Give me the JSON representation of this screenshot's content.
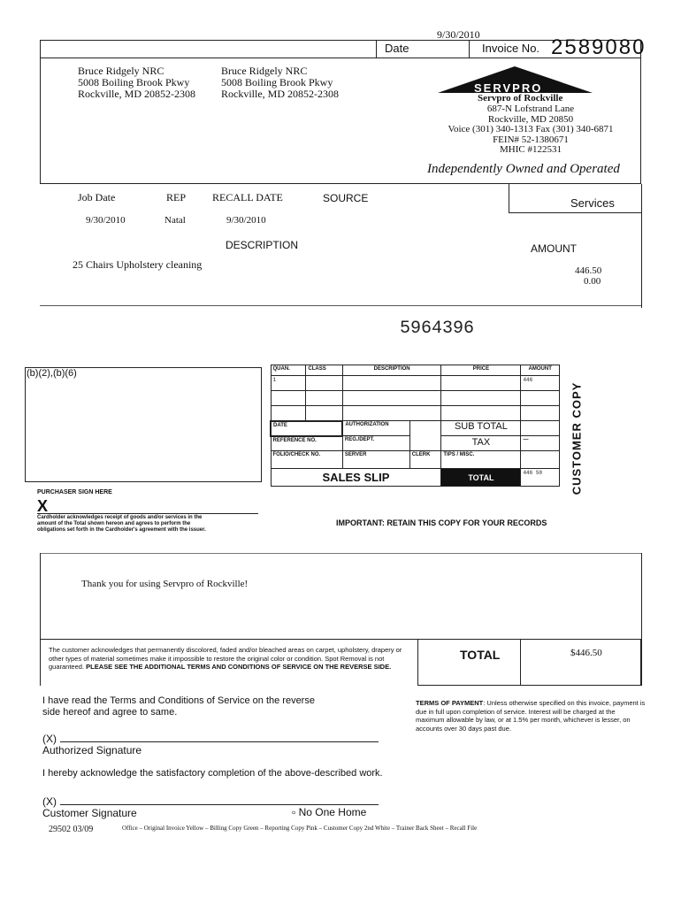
{
  "header": {
    "top_date": "9/30/2010",
    "date_label": "Date",
    "invoice_label": "Invoice No.",
    "invoice_number": "2589080"
  },
  "bill_to": [
    "Bruce Ridgely NRC",
    "5008 Boiling Brook Pkwy",
    "Rockville, MD 20852-2308"
  ],
  "ship_to": [
    "Bruce Ridgely NRC",
    "5008 Boiling Brook Pkwy",
    "Rockville, MD 20852-2308"
  ],
  "company": {
    "logo": "SERVPRO",
    "name": "Servpro of Rockville",
    "lines": [
      "687-N Lofstrand Lane",
      "Rockville, MD 20850",
      "Voice (301) 340-1313  Fax (301) 340-6871",
      "FEIN# 52-1380671",
      "MHIC #122531"
    ],
    "tagline": "Independently Owned and Operated"
  },
  "job": {
    "headers": [
      "Job Date",
      "REP",
      "RECALL DATE",
      "SOURCE"
    ],
    "values": [
      "9/30/2010",
      "Natal",
      "9/30/2010",
      ""
    ],
    "services_label": "Services"
  },
  "items": {
    "description_label": "DESCRIPTION",
    "amount_label": "AMOUNT",
    "rows": [
      {
        "description": "25 Chairs Upholstery cleaning",
        "amount": "446.50"
      },
      {
        "description": "",
        "amount": "0.00"
      }
    ]
  },
  "receipt": {
    "handwritten_number": "5964396",
    "redaction": "(b)(2),(b)(6)",
    "purchaser_label": "PURCHASER SIGN HERE",
    "x_mark": "X",
    "cardholder_text": [
      "Cardholder acknowledges receipt of goods and/or services in the",
      "amount of the Total shown hereon and agrees to perform the",
      "obligations set forth in the Cardholder's agreement with the issuer."
    ],
    "slip": {
      "headers": [
        "QUAN.",
        "CLASS",
        "DESCRIPTION",
        "PRICE",
        "AMOUNT"
      ],
      "quan": "1",
      "amount": "446",
      "date_label": "DATE",
      "authorization_label": "AUTHORIZATION",
      "reference_label": "REFERENCE NO.",
      "reg_label": "REG./DEPT.",
      "folio_label": "FOLIO/CHECK NO.",
      "server_label": "SERVER",
      "clerk_label": "CLERK",
      "subtotal_label": "SUB TOTAL",
      "tax_label": "TAX",
      "tax_value": "—",
      "tips_label": "TIPS / MISC.",
      "title": "SALES SLIP",
      "total_label": "TOTAL",
      "total_value": "446 50"
    },
    "important": "IMPORTANT: RETAIN THIS COPY FOR YOUR RECORDS",
    "customer_copy": "CUSTOMER COPY"
  },
  "thanks": "Thank you for using Servpro of Rockville!",
  "disclaimer": "The customer acknowledges that permanently discolored, faded and/or bleached areas on carpet, upholstery, drapery or other types of material sometimes make it impossible to restore the original color or condition.  Spot Removal is not guaranteed.",
  "disclaimer_bold": "PLEASE SEE THE ADDITIONAL TERMS AND CONDITIONS OF SERVICE ON THE REVERSE SIDE.",
  "total": {
    "label": "TOTAL",
    "value": "$446.50"
  },
  "terms_read": "I have read the Terms and Conditions of Service on the reverse side hereof and agree to same.",
  "terms_payment_label": "TERMS OF PAYMENT",
  "terms_payment": ": Unless otherwise specified on this invoice, payment is due in full upon completion of service.  Interest will be charged at the maximum allowable by law, or at 1.5% per month, whichever is lesser, on accounts over 30 days past due.",
  "sig1_prefix": "(X)",
  "sig1_label": "Authorized Signature",
  "acknowledge": "I hereby acknowledge the satisfactory completion of the above-described work.",
  "sig2_prefix": "(X)",
  "sig2_label": "Customer Signature",
  "no_one_home": "No One Home",
  "footer": {
    "form_no": "29502  03/09",
    "copies": "Office – Original Invoice   Yellow – Billing Copy   Green – Reporting Copy   Pink – Customer Copy   2nd White – Trainer   Back Sheet – Recall File"
  }
}
